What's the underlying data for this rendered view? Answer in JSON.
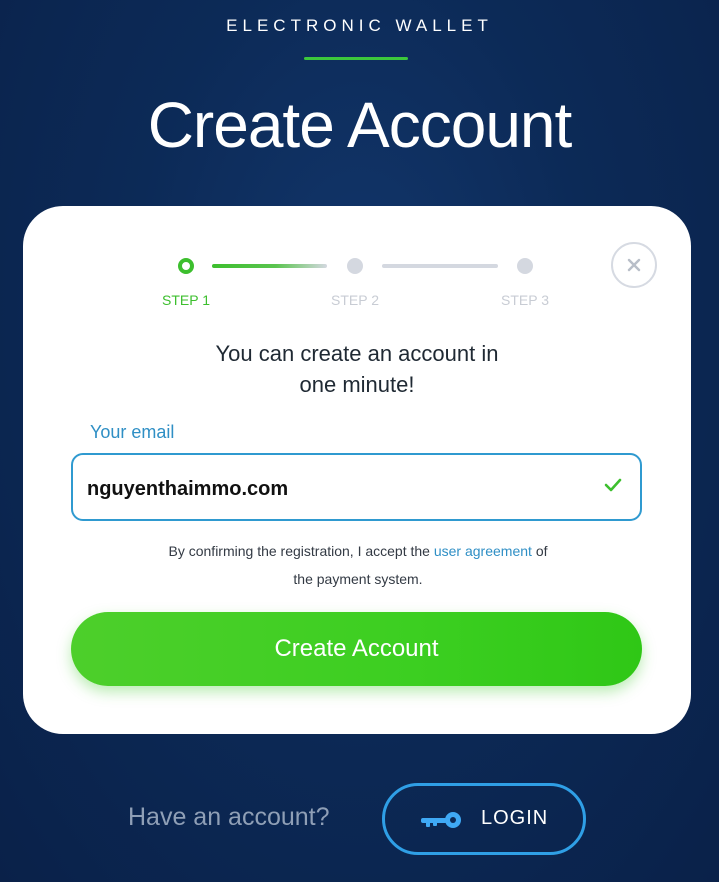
{
  "header": {
    "brand": "ELECTRONIC WALLET",
    "title": "Create Account"
  },
  "stepper": {
    "steps": [
      {
        "label": "STEP 1",
        "state": "active"
      },
      {
        "label": "STEP 2",
        "state": "inactive"
      },
      {
        "label": "STEP 3",
        "state": "inactive"
      }
    ]
  },
  "card": {
    "intro_line1": "You can create an account in",
    "intro_line2": "one minute!",
    "email_label": "Your email",
    "email_value": "nguyenthaimmo.com",
    "agreement_prefix": "By confirming the registration, I accept the",
    "agreement_link": "user agreement",
    "agreement_suffix": "of the payment system.",
    "submit_label": "Create Account",
    "close_icon": "close-icon",
    "check_icon": "check-icon"
  },
  "footer": {
    "have_account": "Have an account?",
    "login_label": "LOGIN",
    "login_icon": "key-icon"
  },
  "colors": {
    "background": "#0c2a57",
    "accent_green": "#3dbf2e",
    "accent_blue": "#2f9ad0",
    "button_green": "#3ccf21"
  }
}
